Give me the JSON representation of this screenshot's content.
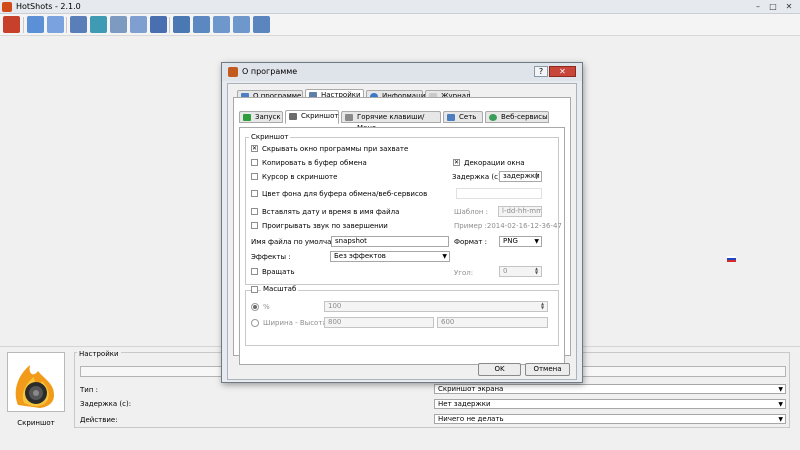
{
  "window": {
    "title": "HotShots - 2.1.0"
  },
  "dialog": {
    "title": "О программе",
    "help_label": "?",
    "close_label": "✕",
    "tabs": [
      {
        "label": "О программе",
        "icon": "info-icon",
        "selected": false
      },
      {
        "label": "Настройки",
        "icon": "settings-icon",
        "selected": true
      },
      {
        "label": "Информация",
        "icon": "info-circle-icon",
        "selected": false
      },
      {
        "label": "Журнал",
        "icon": "log-icon",
        "selected": false
      }
    ],
    "subtabs": [
      {
        "label": "Запуск",
        "icon": "play-icon",
        "selected": false
      },
      {
        "label": "Скриншот",
        "icon": "screenshot-icon",
        "selected": true
      },
      {
        "label": "Горячие клавиши/Мено",
        "icon": "hotkeys-icon",
        "selected": false
      },
      {
        "label": "Сеть",
        "icon": "network-icon",
        "selected": false
      },
      {
        "label": "Веб-сервисы",
        "icon": "web-icon",
        "selected": false
      }
    ],
    "screenshot": {
      "group_label": "Скриншот",
      "hide_window": {
        "label": "Скрывать окно программы при захвате",
        "checked": true
      },
      "copy_clipboard": {
        "label": "Копировать в буфер обмена",
        "checked": false
      },
      "cursor": {
        "label": "Курсор в скриншоте",
        "checked": false
      },
      "bg_color": {
        "label": "Цвет фона для буфера обмена/веб-сервисов",
        "checked": false
      },
      "insert_date": {
        "label": "Вставлять дату и время в имя файла",
        "checked": false
      },
      "play_sound": {
        "label": "Проигрывать звук по завершении",
        "checked": false
      },
      "decorations": {
        "label": "Декорации окна",
        "checked": true
      },
      "delay_label": "Задержка (с):",
      "delay_value": "задержки",
      "template_label": "Шаблон :",
      "template_value": "l-dd-hh-mm-ss",
      "example_text": "Пример :2014-02-16-12-36-47",
      "filename_label": "Имя файла по умолчанию",
      "filename_value": "snapshot",
      "format_label": "Формат :",
      "format_value": "PNG",
      "effects_label": "Эффекты :",
      "effects_value": "Без эффектов",
      "rotate": {
        "label": "Вращать",
        "checked": false
      },
      "angle_label": "Угол:",
      "angle_value": "0"
    },
    "scale": {
      "group_label": "Масштаб",
      "checked": false,
      "percent_label": "%",
      "percent_value": "100",
      "wh_label": "Ширина - Высота",
      "width_value": "800",
      "height_value": "600"
    },
    "ok_label": "OK",
    "cancel_label": "Отмена"
  },
  "bottom": {
    "shot_label": "Скриншот",
    "settings_label": "Настройки",
    "type_label": "Тип :",
    "type_value": "Скриншот экрана",
    "delay_label": "Задержка (с):",
    "delay_value": "Нет задержки",
    "action_label": "Действие:",
    "action_value": "Ничего не делать"
  }
}
